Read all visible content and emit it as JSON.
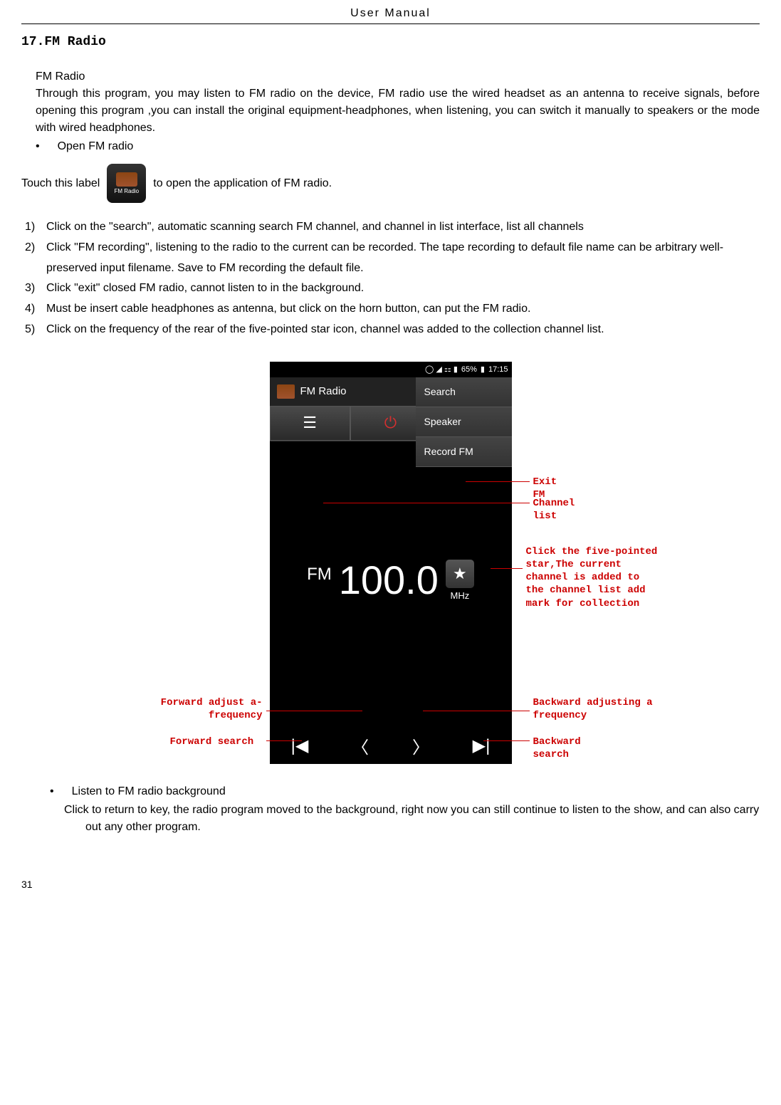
{
  "header": "User  Manual",
  "section_title": "17.FM Radio",
  "subtitle": "FM Radio",
  "intro": "Through this program, you may listen to FM radio on the device, FM radio use the wired headset as an antenna to receive signals, before opening this program ,you can install  the original equipment-headphones, when listening, you can switch it manually  to speakers or the mode with wired headphones.",
  "bullet_open": "Open FM radio",
  "touch_label_pre": "Touch this label",
  "touch_label_post": "to open the application of FM radio.",
  "icon_label": "FM Radio",
  "steps": [
    "Click on the \"search\", automatic scanning search FM channel, and channel in list interface, list all channels",
    "Click \"FM recording\", listening to the radio to the current can be recorded. The tape recording to default file name can be arbitrary well-preserved input filename. Save to FM recording the default file.",
    "Click \"exit\" closed FM radio, cannot listen to in the background.",
    "Must be insert cable headphones as antenna, but click on the horn button, can put the FM radio.",
    "Click on the frequency of the rear of the five-pointed star icon, channel was added to the collection channel list."
  ],
  "phone": {
    "status_battery": "65%",
    "status_time": "17:15",
    "title": "FM Radio",
    "menu": [
      "Search",
      "Speaker",
      "Record FM"
    ],
    "fm_label": "FM",
    "frequency": "100.0",
    "mhz": "MHz"
  },
  "annotations": {
    "exit_fm": "Exit FM",
    "channel_list": "Channel list",
    "star_note": "Click the five-pointed star,The current channel is added to the channel list add mark for collection",
    "forward_adjust": "Forward adjust a-frequency",
    "forward_search": "Forward search",
    "backward_adjust": "Backward adjusting a frequency",
    "backward_search": "Backward search"
  },
  "bullet_listen": "Listen to FM radio background",
  "background_text": "Click to return to key, the radio program moved to the background, right now you can still continue to listen to the show, and can also carry out any other program.",
  "page_number": "31"
}
